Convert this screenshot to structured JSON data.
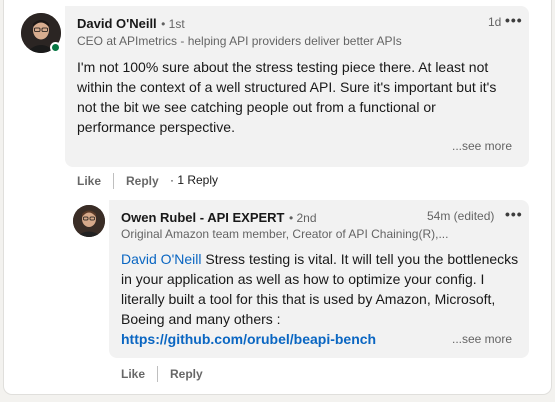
{
  "comment": {
    "author_name": "David O'Neill",
    "degree": "• 1st",
    "headline": "CEO at APImetrics - helping API providers deliver better APIs",
    "time": "1d",
    "more_icon": "ellipsis-icon",
    "body": "I'm not 100% sure about the stress testing piece there. At least not within the context of a well structured API. Sure it's important but it's not the bit we see catching people out from a functional or performance perspective.",
    "see_more": "...see more",
    "actions": {
      "like": "Like",
      "reply": "Reply",
      "reply_count": "· 1 Reply"
    }
  },
  "reply": {
    "author_name": "Owen Rubel - API EXPERT",
    "degree": "• 2nd",
    "headline": "Original Amazon team member, Creator of API Chaining(R),...",
    "time": "54m (edited)",
    "mention": "David O'Neill",
    "body": " Stress testing is vital. It will tell you the bottlenecks in your application as well as how to optimize your config. I literally built a tool for this that is used by Amazon, Microsoft, Boeing and many others :",
    "link": "https://github.com/orubel/beapi-bench",
    "see_more": "...see more",
    "actions": {
      "like": "Like",
      "reply": "Reply"
    }
  },
  "colors": {
    "link": "#0a66c2",
    "bubble": "#f2f2f2",
    "online": "#057642"
  }
}
